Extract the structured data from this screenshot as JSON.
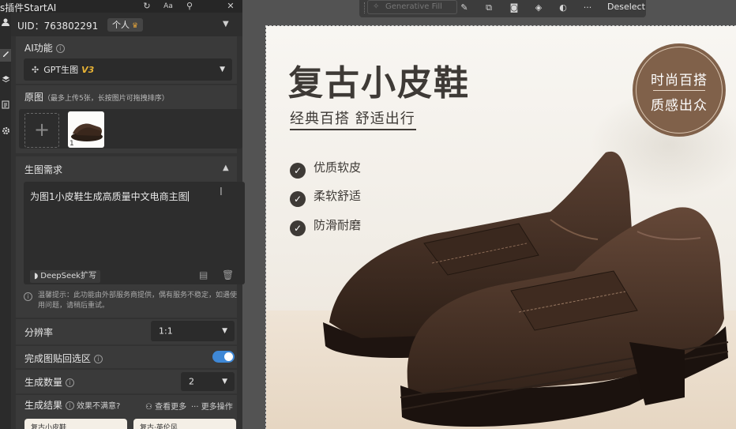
{
  "rail": {
    "icons": [
      "user-icon",
      "brush-icon",
      "layers-icon",
      "document-icon",
      "gear-icon"
    ]
  },
  "panel": {
    "title": "s插件StartAI",
    "titlebar_icons": [
      "refresh-icon",
      "font-size-icon",
      "pin-icon",
      "close-icon"
    ],
    "uid_label": "UID：763802291",
    "account_badge": "个人",
    "ai_function": {
      "label": "AI功能",
      "model_value": "GPT生图",
      "model_version": "V3"
    },
    "source_image": {
      "label": "原图",
      "hint": "（最多上传5张，长按图片可拖拽排序）",
      "add_label": "+",
      "thumb_index": "1"
    },
    "requirement": {
      "label": "生图需求",
      "text": "为图1小皮鞋生成高质量中文电商主图",
      "deepseek_label": "DeepSeek扩写"
    },
    "notice": "温馨提示：此功能由外部服务商提供，偶有服务不稳定，如遇使用问题，请稍后重试。",
    "resolution": {
      "label": "分辨率",
      "value": "1:1"
    },
    "paste_back": {
      "label": "完成图贴回选区",
      "enabled": true
    },
    "quantity": {
      "label": "生成数量",
      "value": "2"
    },
    "results": {
      "label": "生成结果",
      "feedback": "效果不满意?",
      "view_more": "查看更多",
      "more_actions": "更多操作",
      "card_texts": [
        "复古小皮鞋",
        "复古·英伦风"
      ]
    }
  },
  "ps_toolbar": {
    "generative_fill": "Generative Fill",
    "deselect": "Deselect",
    "tool_icons": [
      "brush-icon",
      "transform-icon",
      "mask-icon",
      "fill-bucket-icon",
      "invert-icon",
      "more-icon"
    ]
  },
  "canvas": {
    "title": "复古小皮鞋",
    "subtitle": "经典百搭 舒适出行",
    "features": [
      "优质软皮",
      "柔软舒适",
      "防滑耐磨"
    ],
    "badge_line1": "时尚百搭",
    "badge_line2": "质感出众"
  },
  "colors": {
    "panel_bg": "#323232",
    "accent_toggle": "#3f88d6",
    "v3_gold": "#e7b235",
    "badge_brown": "#80614a",
    "text_dark": "#3e3a36"
  }
}
